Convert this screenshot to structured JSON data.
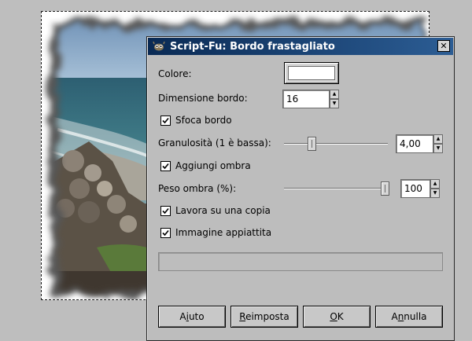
{
  "dialog": {
    "title": "Script-Fu: Bordo frastagliato",
    "close_glyph": "✕",
    "color": {
      "label": "Colore:",
      "value_hex": "#ffffff"
    },
    "border_size": {
      "label": "Dimensione bordo:",
      "value": "16"
    },
    "blur_border": {
      "label": "Sfoca bordo",
      "checked": true
    },
    "granularity": {
      "label": "Granulosità (1 è bassa):",
      "value": "4,00",
      "fraction": 0.25
    },
    "add_shadow": {
      "label": "Aggiungi ombra",
      "checked": true
    },
    "shadow_weight": {
      "label": "Peso ombra (%):",
      "value": "100",
      "fraction": 1.0
    },
    "work_on_copy": {
      "label": "Lavora su una copia",
      "checked": true
    },
    "flatten_image": {
      "label": "Immagine appiattita",
      "checked": true
    },
    "buttons": {
      "help": {
        "pre": "A",
        "key": "i",
        "post": "uto"
      },
      "reset": {
        "pre": "",
        "key": "R",
        "post": "eimposta"
      },
      "ok": {
        "pre": "",
        "key": "O",
        "post": "K"
      },
      "cancel": {
        "pre": "A",
        "key": "n",
        "post": "nulla"
      }
    }
  },
  "colors": {
    "titlebar_start": "#0a2a54",
    "titlebar_end": "#2c5d94",
    "dialog_bg": "#bdbdbd",
    "desktop_bg": "#bebebe"
  },
  "icons": {
    "title": "gimp-wilber-icon",
    "close": "close-icon",
    "check": "checkmark-icon",
    "spin_up": "arrow-up-icon",
    "spin_down": "arrow-down-icon"
  }
}
